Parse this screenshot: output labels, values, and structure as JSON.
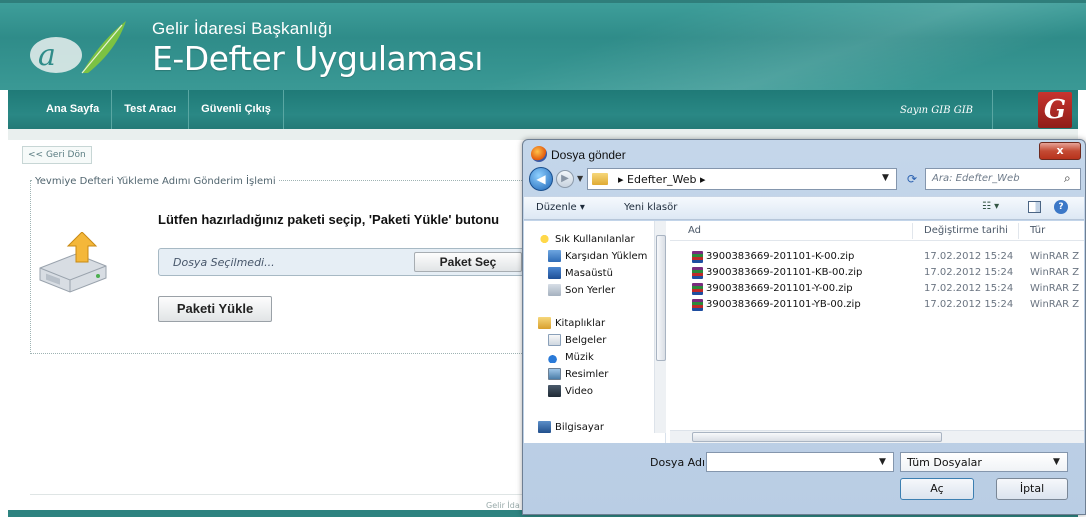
{
  "header": {
    "org_name": "Gelir İdaresi Başkanlığı",
    "app_name": "E-Defter Uygulaması"
  },
  "nav": {
    "items": [
      {
        "label": "Ana Sayfa"
      },
      {
        "label": "Test Aracı"
      },
      {
        "label": "Güvenli Çıkış"
      }
    ],
    "user": "Sayın GIB GIB",
    "gib_logo_letter": "Ğ"
  },
  "main": {
    "back_link": "<< Geri Dön",
    "section_title": "Yevmiye Defteri Yükleme Adımı Gönderim İşlemi",
    "instruction": "Lütfen hazırladığınız paketi seçip, 'Paketi Yükle' butonu",
    "file_placeholder": "Dosya Seçilmedi...",
    "pick_button": "Paket Seç",
    "upload_button": "Paketi Yükle",
    "footer_text": "Gelir İda"
  },
  "dialog": {
    "title": "Dosya gönder",
    "close": "x",
    "path_text": "▸  Edefter_Web  ▸",
    "search_placeholder": "Ara: Edefter_Web",
    "toolbar": {
      "organize": "Düzenle ▾",
      "new_folder": "Yeni klasör"
    },
    "tree": [
      {
        "label": "Sık Kullanılanlar",
        "icon": "star-icon"
      },
      {
        "label": "Karşıdan Yüklem",
        "icon": "download-folder-icon"
      },
      {
        "label": "Masaüstü",
        "icon": "desktop-icon"
      },
      {
        "label": "Son Yerler",
        "icon": "recent-places-icon"
      },
      {
        "label": "Kitaplıklar",
        "icon": "libraries-icon"
      },
      {
        "label": "Belgeler",
        "icon": "documents-icon"
      },
      {
        "label": "Müzik",
        "icon": "music-icon"
      },
      {
        "label": "Resimler",
        "icon": "pictures-icon"
      },
      {
        "label": "Video",
        "icon": "video-icon"
      },
      {
        "label": "Bilgisayar",
        "icon": "computer-icon"
      }
    ],
    "columns": {
      "name": "Ad",
      "date": "Değiştirme tarihi",
      "type": "Tür"
    },
    "files": [
      {
        "name": "3900383669-201101-K-00.zip",
        "date": "17.02.2012 15:24",
        "type": "WinRAR Z"
      },
      {
        "name": "3900383669-201101-KB-00.zip",
        "date": "17.02.2012 15:24",
        "type": "WinRAR Z"
      },
      {
        "name": "3900383669-201101-Y-00.zip",
        "date": "17.02.2012 15:24",
        "type": "WinRAR Z"
      },
      {
        "name": "3900383669-201101-YB-00.zip",
        "date": "17.02.2012 15:24",
        "type": "WinRAR Z"
      }
    ],
    "filename_label": "Dosya Adı:",
    "filename_value": "",
    "filetype": "Tüm Dosyalar",
    "ok_button": "Aç",
    "cancel_button": "İptal"
  }
}
